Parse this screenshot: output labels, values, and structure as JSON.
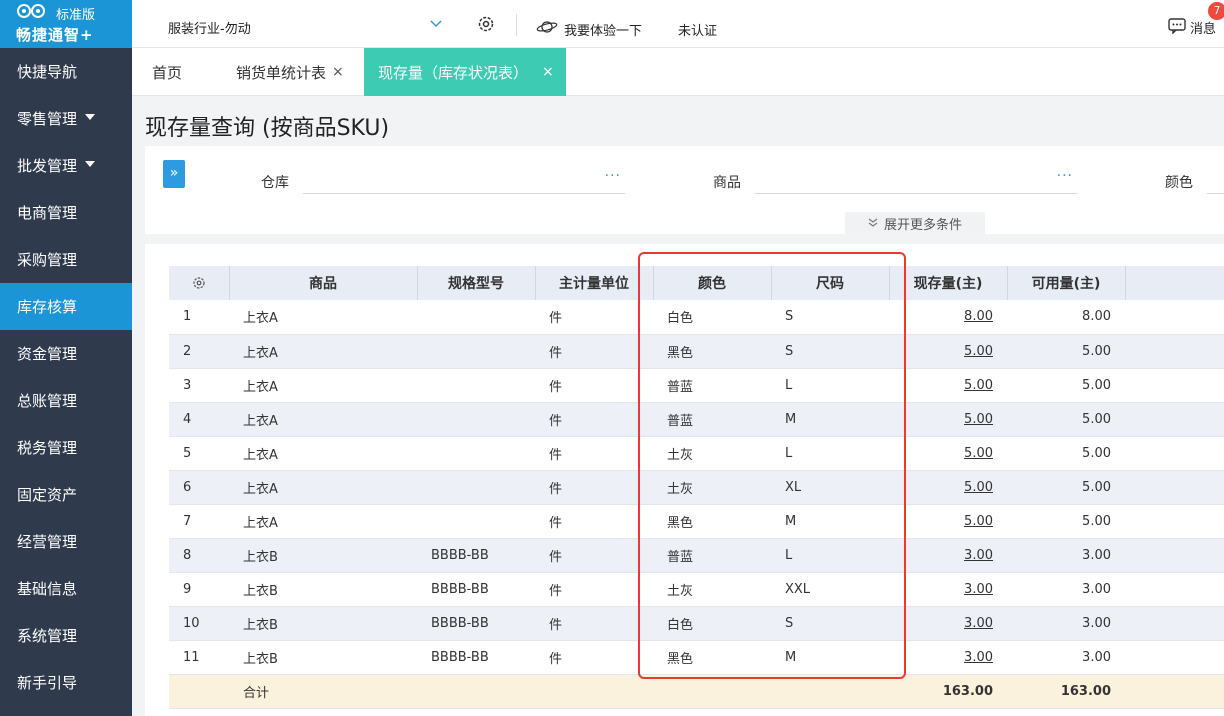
{
  "logo": {
    "edition": "标准版",
    "brand": "畅捷通智+"
  },
  "sidebar": {
    "items": [
      {
        "label": "快捷导航",
        "caret": false,
        "active": false
      },
      {
        "label": "零售管理",
        "caret": true,
        "active": false
      },
      {
        "label": "批发管理",
        "caret": true,
        "active": false
      },
      {
        "label": "电商管理",
        "caret": false,
        "active": false
      },
      {
        "label": "采购管理",
        "caret": false,
        "active": false
      },
      {
        "label": "库存核算",
        "caret": false,
        "active": true
      },
      {
        "label": "资金管理",
        "caret": false,
        "active": false
      },
      {
        "label": "总账管理",
        "caret": false,
        "active": false
      },
      {
        "label": "税务管理",
        "caret": false,
        "active": false
      },
      {
        "label": "固定资产",
        "caret": false,
        "active": false
      },
      {
        "label": "经营管理",
        "caret": false,
        "active": false
      },
      {
        "label": "基础信息",
        "caret": false,
        "active": false
      },
      {
        "label": "系统管理",
        "caret": false,
        "active": false
      },
      {
        "label": "新手引导",
        "caret": false,
        "active": false
      }
    ]
  },
  "topbar": {
    "org": "服装行业-勿动",
    "try_label": "我要体验一下",
    "unverified": "未认证",
    "msg_label": "消息",
    "msg_badge": "7"
  },
  "tabs": {
    "home": "首页",
    "sales": "销货单统计表",
    "active": "现存量（库存状况表）",
    "close": "×"
  },
  "page": {
    "title": "现存量查询 (按商品SKU)"
  },
  "filter": {
    "warehouse_label": "仓库",
    "product_label": "商品",
    "color_label": "颜色",
    "dots": "···",
    "collapse": "»",
    "more": "展开更多条件",
    "more_chev": "≫"
  },
  "grid": {
    "headers": {
      "product": "商品",
      "spec": "规格型号",
      "unit": "主计量单位",
      "color": "颜色",
      "size": "尺码",
      "onhand": "现存量(主)",
      "available": "可用量(主)"
    },
    "rows": [
      {
        "idx": "1",
        "product": "上衣A",
        "spec": "",
        "unit": "件",
        "color": "白色",
        "size": "S",
        "onhand": "8.00",
        "available": "8.00"
      },
      {
        "idx": "2",
        "product": "上衣A",
        "spec": "",
        "unit": "件",
        "color": "黑色",
        "size": "S",
        "onhand": "5.00",
        "available": "5.00"
      },
      {
        "idx": "3",
        "product": "上衣A",
        "spec": "",
        "unit": "件",
        "color": "普蓝",
        "size": "L",
        "onhand": "5.00",
        "available": "5.00"
      },
      {
        "idx": "4",
        "product": "上衣A",
        "spec": "",
        "unit": "件",
        "color": "普蓝",
        "size": "M",
        "onhand": "5.00",
        "available": "5.00"
      },
      {
        "idx": "5",
        "product": "上衣A",
        "spec": "",
        "unit": "件",
        "color": "土灰",
        "size": "L",
        "onhand": "5.00",
        "available": "5.00"
      },
      {
        "idx": "6",
        "product": "上衣A",
        "spec": "",
        "unit": "件",
        "color": "土灰",
        "size": "XL",
        "onhand": "5.00",
        "available": "5.00"
      },
      {
        "idx": "7",
        "product": "上衣A",
        "spec": "",
        "unit": "件",
        "color": "黑色",
        "size": "M",
        "onhand": "5.00",
        "available": "5.00"
      },
      {
        "idx": "8",
        "product": "上衣B",
        "spec": "BBBB-BB",
        "unit": "件",
        "color": "普蓝",
        "size": "L",
        "onhand": "3.00",
        "available": "3.00"
      },
      {
        "idx": "9",
        "product": "上衣B",
        "spec": "BBBB-BB",
        "unit": "件",
        "color": "土灰",
        "size": "XXL",
        "onhand": "3.00",
        "available": "3.00"
      },
      {
        "idx": "10",
        "product": "上衣B",
        "spec": "BBBB-BB",
        "unit": "件",
        "color": "白色",
        "size": "S",
        "onhand": "3.00",
        "available": "3.00"
      },
      {
        "idx": "11",
        "product": "上衣B",
        "spec": "BBBB-BB",
        "unit": "件",
        "color": "黑色",
        "size": "M",
        "onhand": "3.00",
        "available": "3.00"
      }
    ],
    "total": {
      "label": "合计",
      "onhand": "163.00",
      "available": "163.00"
    }
  },
  "colors": {
    "sidebar_bg": "#2f3a4c",
    "accent": "#1b95d6",
    "active_tab": "#3ecbb3",
    "highlight": "#e83a30"
  }
}
